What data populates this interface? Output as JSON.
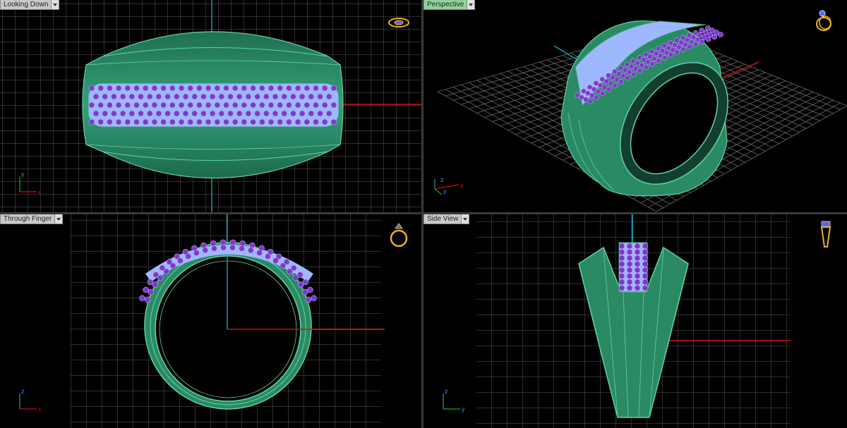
{
  "viewports": {
    "top_left": {
      "label": "Looking Down",
      "active": false,
      "axes": [
        "y",
        "x"
      ]
    },
    "top_right": {
      "label": "Perspective",
      "active": true,
      "axes": [
        "z",
        "y",
        "x"
      ]
    },
    "bottom_left": {
      "label": "Through Finger",
      "active": false,
      "axes": [
        "z",
        "x"
      ]
    },
    "bottom_right": {
      "label": "Side View",
      "active": false,
      "axes": [
        "z",
        "y"
      ]
    }
  },
  "colors": {
    "background": "#000000",
    "grid": "#6a6a6a",
    "grid_major": "#9a9a9a",
    "ring_metal": "#2f8f6a",
    "ring_edge": "#5fd4a4",
    "gem_amethyst": "#7a3cc8",
    "gem_pave": "#9db8ff",
    "axis_x": "#d01010",
    "axis_y": "#10b010",
    "axis_z": "#10a0b0",
    "icon_gold": "#f0b020"
  },
  "icons": {
    "top_left": "ring-top-view-icon",
    "top_right": "ring-perspective-icon",
    "bottom_left": "ring-front-icon",
    "bottom_right": "ring-side-icon"
  }
}
